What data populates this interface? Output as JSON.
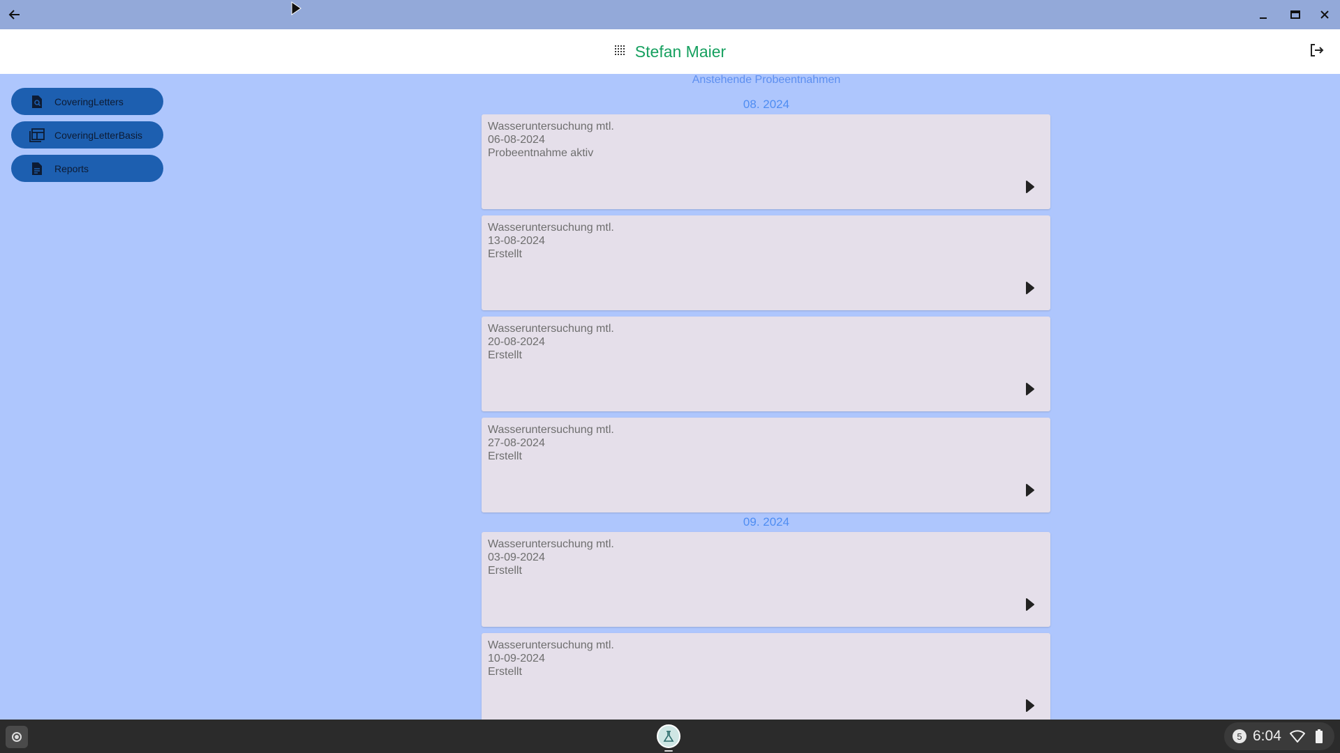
{
  "header": {
    "user_name": "Stefan Maier"
  },
  "sidebar": {
    "items": [
      {
        "label": "CoveringLetters",
        "icon": "document-search-icon"
      },
      {
        "label": "CoveringLetterBasis",
        "icon": "template-icon"
      },
      {
        "label": "Reports",
        "icon": "report-icon"
      }
    ]
  },
  "main": {
    "title": "Anstehende Probeentnahmen",
    "groups": [
      {
        "month": "08. 2024",
        "items": [
          {
            "title": "Wasseruntersuchung mtl.",
            "date": "06-08-2024",
            "status": "Probeentnahme aktiv"
          },
          {
            "title": "Wasseruntersuchung mtl.",
            "date": "13-08-2024",
            "status": "Erstellt"
          },
          {
            "title": "Wasseruntersuchung mtl.",
            "date": "20-08-2024",
            "status": "Erstellt"
          },
          {
            "title": "Wasseruntersuchung mtl.",
            "date": "27-08-2024",
            "status": "Erstellt"
          }
        ]
      },
      {
        "month": "09. 2024",
        "items": [
          {
            "title": "Wasseruntersuchung mtl.",
            "date": "03-09-2024",
            "status": "Erstellt"
          },
          {
            "title": "Wasseruntersuchung mtl.",
            "date": "10-09-2024",
            "status": "Erstellt"
          }
        ]
      }
    ]
  },
  "taskbar": {
    "time": "6:04",
    "notification_count": "5"
  },
  "colors": {
    "page_background": "#aec6fd",
    "title_bar": "#93a9d9",
    "accent_green": "#16a05f",
    "sidebar_button": "#1d5fb0",
    "card_background": "#e5dfea",
    "month_label": "#4f8df2"
  }
}
